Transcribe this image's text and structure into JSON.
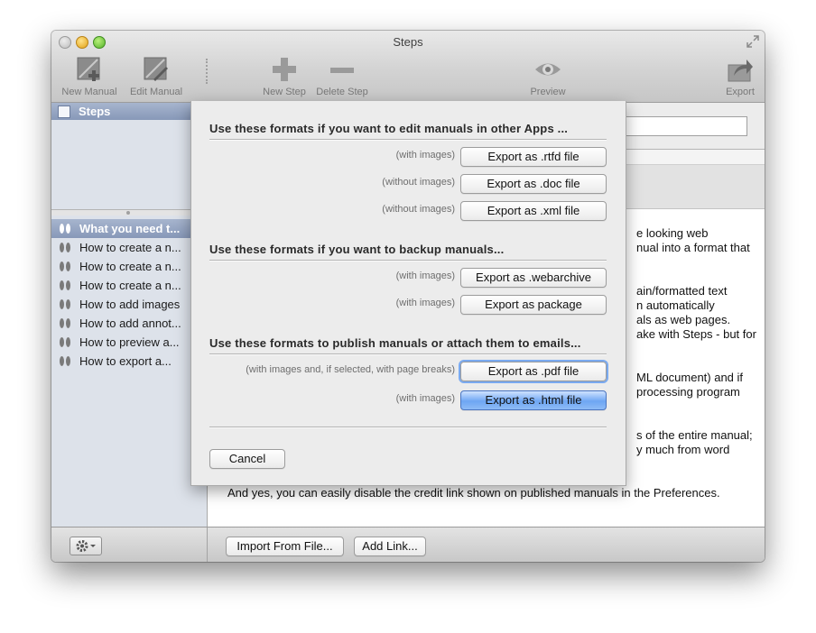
{
  "window": {
    "title": "Steps"
  },
  "toolbar": {
    "new_manual": "New Manual",
    "edit_manual": "Edit Manual",
    "new_step": "New Step",
    "delete_step": "Delete Step",
    "preview": "Preview",
    "export": "Export"
  },
  "sidebar": {
    "header": "Steps",
    "steps": [
      "What you need t...",
      "How to create a n...",
      "How to create a n...",
      "How to create a n...",
      "How to add images",
      "How to add annot...",
      "How to preview a...",
      "How to export a..."
    ]
  },
  "main": {
    "lines": [
      "e looking web",
      "nual into a format that",
      "ain/formatted text",
      "n automatically",
      "als as web pages.",
      "ake with Steps - but for",
      "ML document) and if",
      "processing program",
      "s of the entire manual;",
      "y much from word",
      "And yes, you can easily disable the credit link shown on published manuals in the Preferences."
    ]
  },
  "bottom": {
    "import_label": "Import From File...",
    "add_link_label": "Add Link..."
  },
  "export_sheet": {
    "edit_section": {
      "title": "Use these formats if you want to edit manuals in other Apps ...",
      "options": [
        {
          "note": "(with images)",
          "label": "Export as .rtfd file"
        },
        {
          "note": "(without images)",
          "label": "Export as .doc file"
        },
        {
          "note": "(without images)",
          "label": "Export as .xml file"
        }
      ]
    },
    "backup_section": {
      "title": "Use these formats if you want to backup manuals...",
      "options": [
        {
          "note": "(with images)",
          "label": "Export as .webarchive"
        },
        {
          "note": "(with images)",
          "label": "Export as package"
        }
      ]
    },
    "publish_section": {
      "title": "Use these formats to publish manuals or attach them to emails...",
      "options": [
        {
          "note": "(with images and, if selected, with page breaks)",
          "label": "Export as .pdf file"
        },
        {
          "note": "(with images)",
          "label": "Export as .html file"
        }
      ]
    },
    "cancel_label": "Cancel"
  },
  "colors": {
    "selection": "#8c9dbd",
    "default_button": "#6ea6f3",
    "focus_ring": "#7aaaf0"
  }
}
